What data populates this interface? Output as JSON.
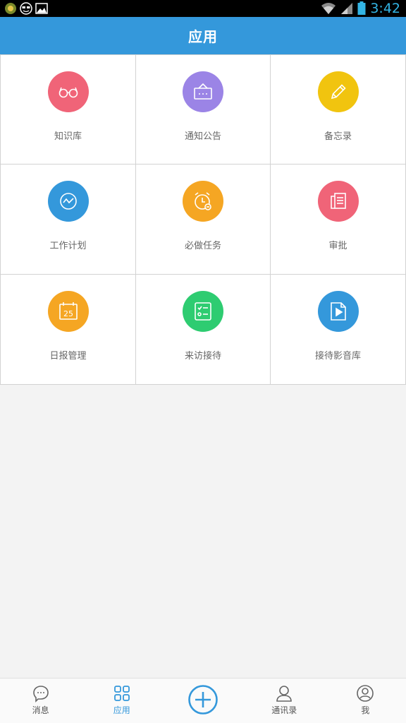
{
  "status_bar": {
    "time": "3:42"
  },
  "header": {
    "title": "应用"
  },
  "apps": [
    {
      "label": "知识库",
      "icon": "glasses-icon",
      "color": "#f06478"
    },
    {
      "label": "通知公告",
      "icon": "signboard-icon",
      "color": "#9b84e6"
    },
    {
      "label": "备忘录",
      "icon": "pencil-icon",
      "color": "#f1c40f"
    },
    {
      "label": "工作计划",
      "icon": "trend-icon",
      "color": "#3498db"
    },
    {
      "label": "必做任务",
      "icon": "alarm-clock-icon",
      "color": "#f5a623"
    },
    {
      "label": "审批",
      "icon": "document-icon",
      "color": "#f06478"
    },
    {
      "label": "日报管理",
      "icon": "calendar-icon",
      "color": "#f5a623",
      "calendar_day": "25"
    },
    {
      "label": "来访接待",
      "icon": "checklist-icon",
      "color": "#2ecc71"
    },
    {
      "label": "接待影音库",
      "icon": "play-file-icon",
      "color": "#3498db"
    }
  ],
  "bottom_nav": {
    "items": [
      {
        "label": "消息",
        "icon": "chat-bubble-icon"
      },
      {
        "label": "应用",
        "icon": "grid-icon",
        "active": true
      },
      {
        "label": "",
        "icon": "add-circle-icon"
      },
      {
        "label": "通讯录",
        "icon": "contact-icon"
      },
      {
        "label": "我",
        "icon": "profile-icon"
      }
    ]
  },
  "colors": {
    "accent": "#3498db",
    "nav_inactive": "#555555"
  }
}
